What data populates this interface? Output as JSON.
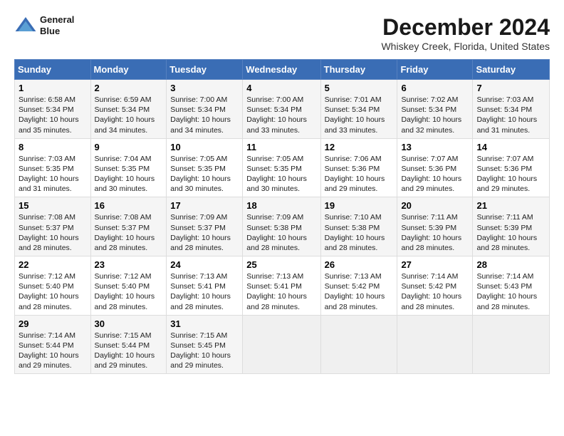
{
  "header": {
    "logo_line1": "General",
    "logo_line2": "Blue",
    "month_title": "December 2024",
    "location": "Whiskey Creek, Florida, United States"
  },
  "days_of_week": [
    "Sunday",
    "Monday",
    "Tuesday",
    "Wednesday",
    "Thursday",
    "Friday",
    "Saturday"
  ],
  "weeks": [
    [
      {
        "day": "1",
        "text": "Sunrise: 6:58 AM\nSunset: 5:34 PM\nDaylight: 10 hours\nand 35 minutes."
      },
      {
        "day": "2",
        "text": "Sunrise: 6:59 AM\nSunset: 5:34 PM\nDaylight: 10 hours\nand 34 minutes."
      },
      {
        "day": "3",
        "text": "Sunrise: 7:00 AM\nSunset: 5:34 PM\nDaylight: 10 hours\nand 34 minutes."
      },
      {
        "day": "4",
        "text": "Sunrise: 7:00 AM\nSunset: 5:34 PM\nDaylight: 10 hours\nand 33 minutes."
      },
      {
        "day": "5",
        "text": "Sunrise: 7:01 AM\nSunset: 5:34 PM\nDaylight: 10 hours\nand 33 minutes."
      },
      {
        "day": "6",
        "text": "Sunrise: 7:02 AM\nSunset: 5:34 PM\nDaylight: 10 hours\nand 32 minutes."
      },
      {
        "day": "7",
        "text": "Sunrise: 7:03 AM\nSunset: 5:34 PM\nDaylight: 10 hours\nand 31 minutes."
      }
    ],
    [
      {
        "day": "8",
        "text": "Sunrise: 7:03 AM\nSunset: 5:35 PM\nDaylight: 10 hours\nand 31 minutes."
      },
      {
        "day": "9",
        "text": "Sunrise: 7:04 AM\nSunset: 5:35 PM\nDaylight: 10 hours\nand 30 minutes."
      },
      {
        "day": "10",
        "text": "Sunrise: 7:05 AM\nSunset: 5:35 PM\nDaylight: 10 hours\nand 30 minutes."
      },
      {
        "day": "11",
        "text": "Sunrise: 7:05 AM\nSunset: 5:35 PM\nDaylight: 10 hours\nand 30 minutes."
      },
      {
        "day": "12",
        "text": "Sunrise: 7:06 AM\nSunset: 5:36 PM\nDaylight: 10 hours\nand 29 minutes."
      },
      {
        "day": "13",
        "text": "Sunrise: 7:07 AM\nSunset: 5:36 PM\nDaylight: 10 hours\nand 29 minutes."
      },
      {
        "day": "14",
        "text": "Sunrise: 7:07 AM\nSunset: 5:36 PM\nDaylight: 10 hours\nand 29 minutes."
      }
    ],
    [
      {
        "day": "15",
        "text": "Sunrise: 7:08 AM\nSunset: 5:37 PM\nDaylight: 10 hours\nand 28 minutes."
      },
      {
        "day": "16",
        "text": "Sunrise: 7:08 AM\nSunset: 5:37 PM\nDaylight: 10 hours\nand 28 minutes."
      },
      {
        "day": "17",
        "text": "Sunrise: 7:09 AM\nSunset: 5:37 PM\nDaylight: 10 hours\nand 28 minutes."
      },
      {
        "day": "18",
        "text": "Sunrise: 7:09 AM\nSunset: 5:38 PM\nDaylight: 10 hours\nand 28 minutes."
      },
      {
        "day": "19",
        "text": "Sunrise: 7:10 AM\nSunset: 5:38 PM\nDaylight: 10 hours\nand 28 minutes."
      },
      {
        "day": "20",
        "text": "Sunrise: 7:11 AM\nSunset: 5:39 PM\nDaylight: 10 hours\nand 28 minutes."
      },
      {
        "day": "21",
        "text": "Sunrise: 7:11 AM\nSunset: 5:39 PM\nDaylight: 10 hours\nand 28 minutes."
      }
    ],
    [
      {
        "day": "22",
        "text": "Sunrise: 7:12 AM\nSunset: 5:40 PM\nDaylight: 10 hours\nand 28 minutes."
      },
      {
        "day": "23",
        "text": "Sunrise: 7:12 AM\nSunset: 5:40 PM\nDaylight: 10 hours\nand 28 minutes."
      },
      {
        "day": "24",
        "text": "Sunrise: 7:13 AM\nSunset: 5:41 PM\nDaylight: 10 hours\nand 28 minutes."
      },
      {
        "day": "25",
        "text": "Sunrise: 7:13 AM\nSunset: 5:41 PM\nDaylight: 10 hours\nand 28 minutes."
      },
      {
        "day": "26",
        "text": "Sunrise: 7:13 AM\nSunset: 5:42 PM\nDaylight: 10 hours\nand 28 minutes."
      },
      {
        "day": "27",
        "text": "Sunrise: 7:14 AM\nSunset: 5:42 PM\nDaylight: 10 hours\nand 28 minutes."
      },
      {
        "day": "28",
        "text": "Sunrise: 7:14 AM\nSunset: 5:43 PM\nDaylight: 10 hours\nand 28 minutes."
      }
    ],
    [
      {
        "day": "29",
        "text": "Sunrise: 7:14 AM\nSunset: 5:44 PM\nDaylight: 10 hours\nand 29 minutes."
      },
      {
        "day": "30",
        "text": "Sunrise: 7:15 AM\nSunset: 5:44 PM\nDaylight: 10 hours\nand 29 minutes."
      },
      {
        "day": "31",
        "text": "Sunrise: 7:15 AM\nSunset: 5:45 PM\nDaylight: 10 hours\nand 29 minutes."
      },
      {
        "day": "",
        "text": ""
      },
      {
        "day": "",
        "text": ""
      },
      {
        "day": "",
        "text": ""
      },
      {
        "day": "",
        "text": ""
      }
    ]
  ]
}
